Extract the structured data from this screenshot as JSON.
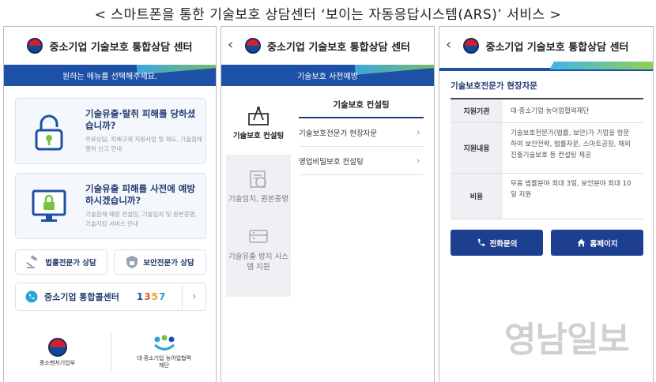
{
  "caption": "< 스마트폰을 통한 기술보호 상담센터 ‘보이는 자동응답시스템(ARS)’ 서비스 >",
  "app_title": "중소기업 기술보호 통합상담 센터",
  "screen1": {
    "banner": "원하는 메뉴를 선택해주세요.",
    "cards": [
      {
        "title": "기술유출·탈취 피해를 당하셨습니까?",
        "desc": "무료상담, 피해구제 지원사업 및 제도, 기술침해행위 신고 안내",
        "icon": "lock-icon"
      },
      {
        "title": "기술유출 피해를 사전에 예방 하시겠습니까?",
        "desc": "기술침해 예방 컨설팅, 기술임치 및 원본증명, 기술지킴 서비스 안내",
        "icon": "monitor-lock-icon"
      }
    ],
    "buttons": [
      {
        "label": "법률전문가 상담",
        "icon": "gavel-icon"
      },
      {
        "label": "보안전문가 상담",
        "icon": "shield-icon"
      }
    ],
    "callcenter": {
      "label": "중소기업 통합콜센터",
      "number": "1357"
    },
    "logos": [
      {
        "name": "중소벤처기업부"
      },
      {
        "name": "대·중소기업 농어업협력재단"
      }
    ]
  },
  "screen2": {
    "banner": "기술보호 사전예방",
    "sidebar": [
      {
        "label": "기술보호 컨설팅",
        "icon": "blueprint-icon",
        "active": true
      },
      {
        "label": "기술임치, 원본증명",
        "icon": "stamp-icon",
        "active": false
      },
      {
        "label": "기술유출 방지 시스템 지원",
        "icon": "server-icon",
        "active": false
      }
    ],
    "section_title": "기술보호 컨설팅",
    "items": [
      "기술보호전문가 현장자문",
      "영업비밀보호 컨설팅"
    ]
  },
  "screen3": {
    "title": "기술보호전문가 현장자문",
    "rows": [
      {
        "key": "지원기관",
        "value": "대·중소기업·농어업협력재단"
      },
      {
        "key": "지원내용",
        "value": "기술보호전문가(법률, 보안)가 기업을 방문하여 보안전략, 법률자문, 스마트공장, 해외진출기술보호 등 컨설팅 제공"
      },
      {
        "key": "비용",
        "value": "무료 법률분야 최대 3일, 보안분야 최대 10일 지원"
      }
    ],
    "buttons": [
      {
        "label": "전화문의",
        "icon": "phone-icon"
      },
      {
        "label": "홈페이지",
        "icon": "home-icon"
      }
    ]
  },
  "watermark": "영남일보",
  "colors": {
    "primary": "#1d50a7",
    "navy": "#243a70",
    "accent_green": "#8fd14f",
    "accent_sky": "#44b4e8"
  }
}
